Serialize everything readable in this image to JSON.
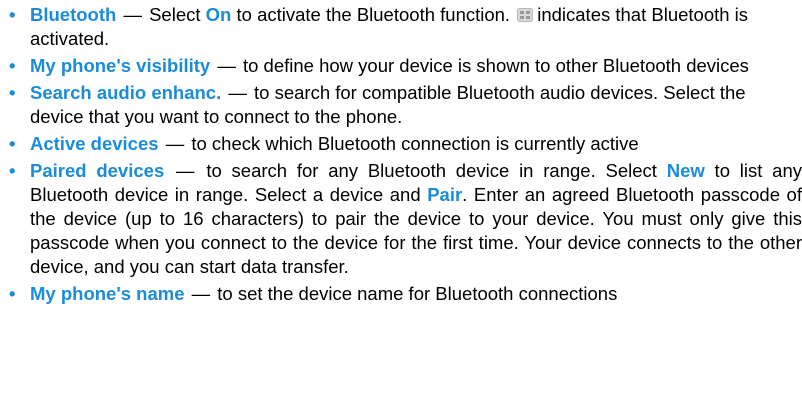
{
  "colors": {
    "accent": "#1a8cd8",
    "text": "#000000"
  },
  "bullet_glyph": "•",
  "dash": "—",
  "items": [
    {
      "term": "Bluetooth",
      "text_1": " Select ",
      "inline_1": "On",
      "text_2": " to activate the Bluetooth function.",
      "icon": "bluetooth-status-icon",
      "text_3": "indicates that Bluetooth is activated."
    },
    {
      "term": "My phone's visibility",
      "text_1": " to define how your device is shown to other Bluetooth devices"
    },
    {
      "term": "Search audio enhanc.",
      "text_1": " to search for compatible Bluetooth audio devices. Select the device that you want to connect to the phone."
    },
    {
      "term": "Active devices",
      "text_1": " to check which Bluetooth connection is currently active"
    },
    {
      "term": "Paired devices",
      "text_1": " to search for any Bluetooth device in range. Select ",
      "inline_1": "New",
      "text_2": " to list any Bluetooth device in range. Select a device and ",
      "inline_2": "Pair",
      "text_3": ". Enter an agreed Bluetooth passcode of the device (up to 16 characters) to pair the device to your device. You must only give this passcode when you connect to the device for the first time. Your device connects to the other device, and you can start data transfer."
    },
    {
      "term": "My phone's name",
      "text_1": " to set the device name for Bluetooth connections"
    }
  ]
}
